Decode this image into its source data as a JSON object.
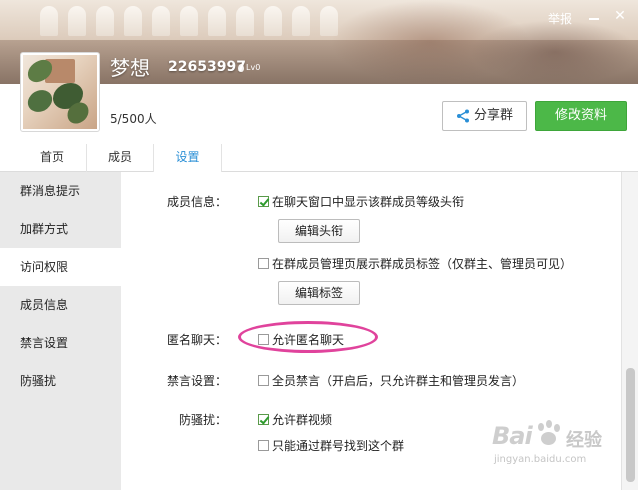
{
  "header": {
    "report_label": "举报",
    "group_name": "梦想",
    "group_id": "22653997",
    "level_badge": "Lv0",
    "member_count": "5/500人"
  },
  "actions": {
    "share_label": "分享群",
    "edit_label": "修改资料"
  },
  "tabs": [
    {
      "label": "首页"
    },
    {
      "label": "成员"
    },
    {
      "label": "设置"
    }
  ],
  "sidebar": {
    "active_index": 2,
    "items": [
      {
        "label": "群消息提示"
      },
      {
        "label": "加群方式"
      },
      {
        "label": "访问权限"
      },
      {
        "label": "成员信息"
      },
      {
        "label": "禁言设置"
      },
      {
        "label": "防骚扰"
      }
    ]
  },
  "settings": {
    "member_info": {
      "label": "成员信息：",
      "option1": {
        "text": "在聊天窗口中显示该群成员等级头衔",
        "checked": true
      },
      "edit_title_button": "编辑头衔",
      "option2": {
        "text": "在群成员管理页展示群成员标签（仅群主、管理员可见）",
        "checked": false
      },
      "edit_tag_button": "编辑标签"
    },
    "anonymous": {
      "label": "匿名聊天：",
      "option": {
        "text": "允许匿名聊天",
        "checked": false
      }
    },
    "mute": {
      "label": "禁言设置：",
      "option": {
        "text": "全员禁言（开启后，只允许群主和管理员发言）",
        "checked": false
      }
    },
    "anti_harass": {
      "label": "防骚扰：",
      "option1": {
        "text": "允许群视频",
        "checked": true
      },
      "option2": {
        "text": "只能通过群号找到这个群",
        "checked": false
      }
    }
  },
  "watermark": {
    "logo": "Bai",
    "text": "经验",
    "url": "jingyan.baidu.com"
  },
  "colors": {
    "accent_blue": "#2a8fd6",
    "edit_green": "#4cb848",
    "highlight_pink": "#e0439c"
  }
}
